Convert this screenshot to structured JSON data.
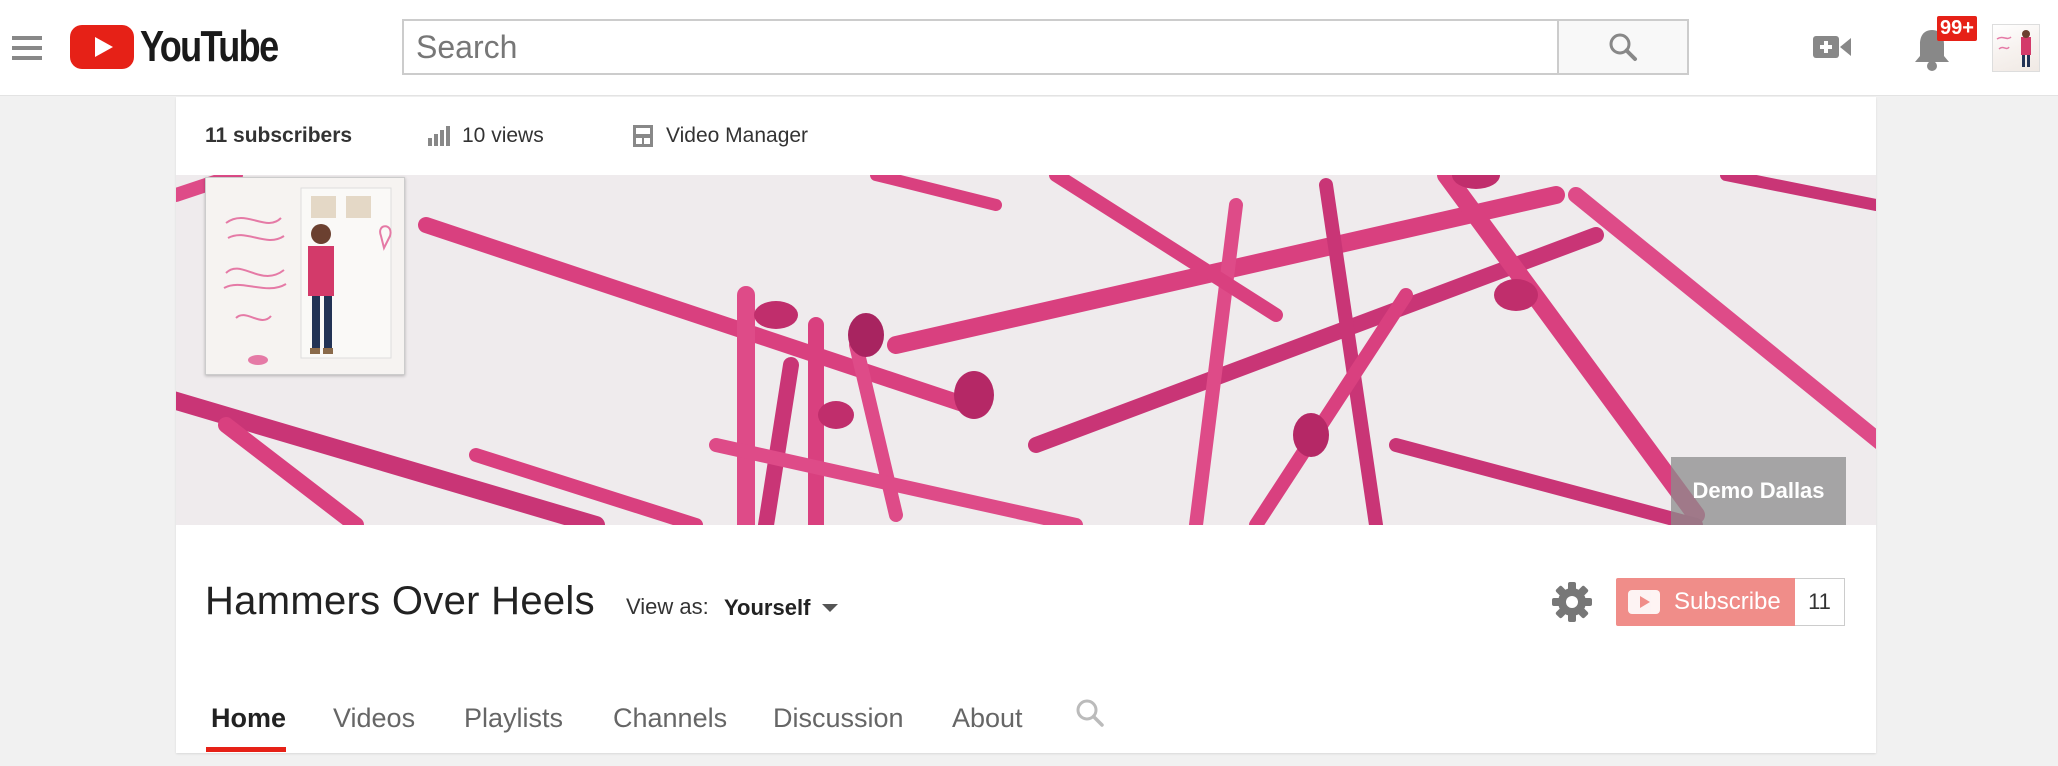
{
  "masthead": {
    "logo_text": "YouTube",
    "search_placeholder": "Search",
    "notification_badge": "99+"
  },
  "channel": {
    "stats": {
      "subscribers": "11 subscribers",
      "views": "10 views",
      "video_manager": "Video Manager"
    },
    "banner_link": "Demo Dallas",
    "title": "Hammers Over Heels",
    "view_as_label": "View as:",
    "view_as_value": "Yourself",
    "subscribe_label": "Subscribe",
    "subscriber_count": "11"
  },
  "tabs": [
    {
      "label": "Home",
      "active": true
    },
    {
      "label": "Videos"
    },
    {
      "label": "Playlists"
    },
    {
      "label": "Channels"
    },
    {
      "label": "Discussion"
    },
    {
      "label": "About"
    }
  ],
  "colors": {
    "brand_red": "#e62117",
    "subscribe_pink": "#f08d89",
    "banner_pink": "#d9407f"
  },
  "icons": [
    "menu-icon",
    "search-icon",
    "video-camera-icon",
    "bell-icon",
    "bar-chart-icon",
    "video-manager-icon",
    "gear-icon",
    "play-icon"
  ]
}
